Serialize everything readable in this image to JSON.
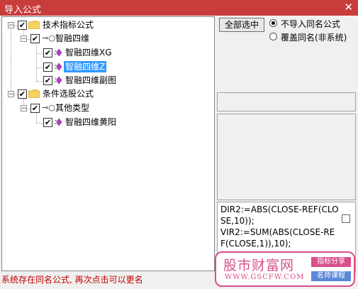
{
  "window": {
    "title": "导入公式",
    "close_glyph": "✕"
  },
  "tree": {
    "nodes": [
      {
        "id": "n0",
        "label": "技术指标公式",
        "checked": true,
        "expanded": true,
        "icon": "folder-icon"
      },
      {
        "id": "n1",
        "label": "智融四维",
        "checked": true,
        "expanded": true,
        "icon": "key-icon"
      },
      {
        "id": "n2",
        "label": "智融四维XG",
        "checked": true,
        "icon": "formula-leaf-icon"
      },
      {
        "id": "n3",
        "label": "智融四维Z",
        "checked": true,
        "selected": true,
        "icon": "formula-leaf-icon"
      },
      {
        "id": "n4",
        "label": "智融四维副图",
        "checked": true,
        "icon": "formula-leaf-icon"
      },
      {
        "id": "n5",
        "label": "条件选股公式",
        "checked": true,
        "expanded": true,
        "icon": "folder-icon"
      },
      {
        "id": "n6",
        "label": "其他类型",
        "checked": true,
        "expanded": true,
        "icon": "key-icon"
      },
      {
        "id": "n7",
        "label": "智融四维黄阳",
        "checked": true,
        "icon": "formula-leaf-icon"
      }
    ]
  },
  "actions": {
    "select_all": "全部选中",
    "radio_skip": "不导入同名公式",
    "radio_overwrite": "覆盖同名(非系统)",
    "selected_radio": "skip"
  },
  "formula": {
    "text": "DIR2:=ABS(CLOSE-REF(CLOSE,10));\nVIR2:=SUM(ABS(CLOSE-REF(CLOSE,1)),10);"
  },
  "status": {
    "message": "系统存在同名公式, 再次点击可以更名"
  },
  "watermark": {
    "name": "股市财富网",
    "url": "WWW.GSCFW.COM",
    "tag1": "指标分享",
    "tag2": "名师课程"
  },
  "colors": {
    "titlebar": "#c83c3c",
    "selection": "#3399ff",
    "watermark": "#d94f8a",
    "status": "#c00000"
  }
}
